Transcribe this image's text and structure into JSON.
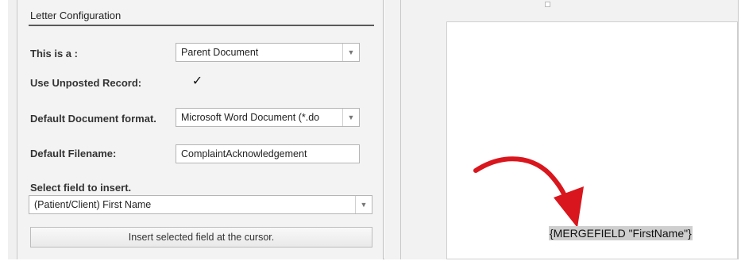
{
  "panel": {
    "title": "Letter Configuration",
    "this_is_a_label": "This is a :",
    "this_is_a_value": "Parent Document",
    "use_unposted_label": "Use Unposted Record:",
    "use_unposted_checked": true,
    "check_glyph": "✓",
    "default_format_label": "Default Document format.",
    "default_format_value": "Microsoft Word Document (*.do",
    "default_filename_label": "Default Filename:",
    "default_filename_value": "ComplaintAcknowledgement",
    "select_field_label": "Select field to insert.",
    "select_field_value": "(Patient/Client) First Name",
    "insert_button_label": "Insert selected field at the cursor.",
    "dropdown_glyph": "▼"
  },
  "document": {
    "mergefield_text": "{MERGEFIELD \"FirstName\"}"
  },
  "colors": {
    "arrow": "#d9161d"
  },
  "icons": {
    "dropdown": "chevron-down-icon",
    "annotation": "red-curved-arrow-icon"
  }
}
